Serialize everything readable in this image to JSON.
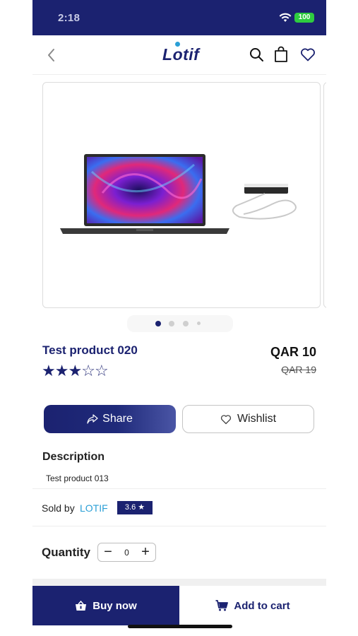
{
  "status_bar": {
    "time": "2:18",
    "battery": "100"
  },
  "header": {
    "logo": "Lotif",
    "logo_prefix": "L",
    "logo_o": "o",
    "logo_suffix": "tif"
  },
  "product": {
    "title": "Test product 020",
    "price": "QAR 10",
    "old_price": "QAR 19",
    "rating_stars": 3,
    "rating_max": 5,
    "image_count": 4,
    "active_image": 1
  },
  "actions": {
    "share_label": "Share",
    "wishlist_label": "Wishlist"
  },
  "description": {
    "heading": "Description",
    "text": "Test product 013"
  },
  "seller": {
    "sold_by_label": "Sold by",
    "name": "LOTIF",
    "rating": "3.6 ★"
  },
  "quantity": {
    "label": "Quantity",
    "value": "0",
    "minus": "−",
    "plus": "+"
  },
  "footer": {
    "buy_now_label": "Buy now",
    "add_to_cart_label": "Add to cart"
  },
  "colors": {
    "primary": "#1b2270",
    "accent": "#2a9fd6",
    "battery": "#2ecc40"
  }
}
